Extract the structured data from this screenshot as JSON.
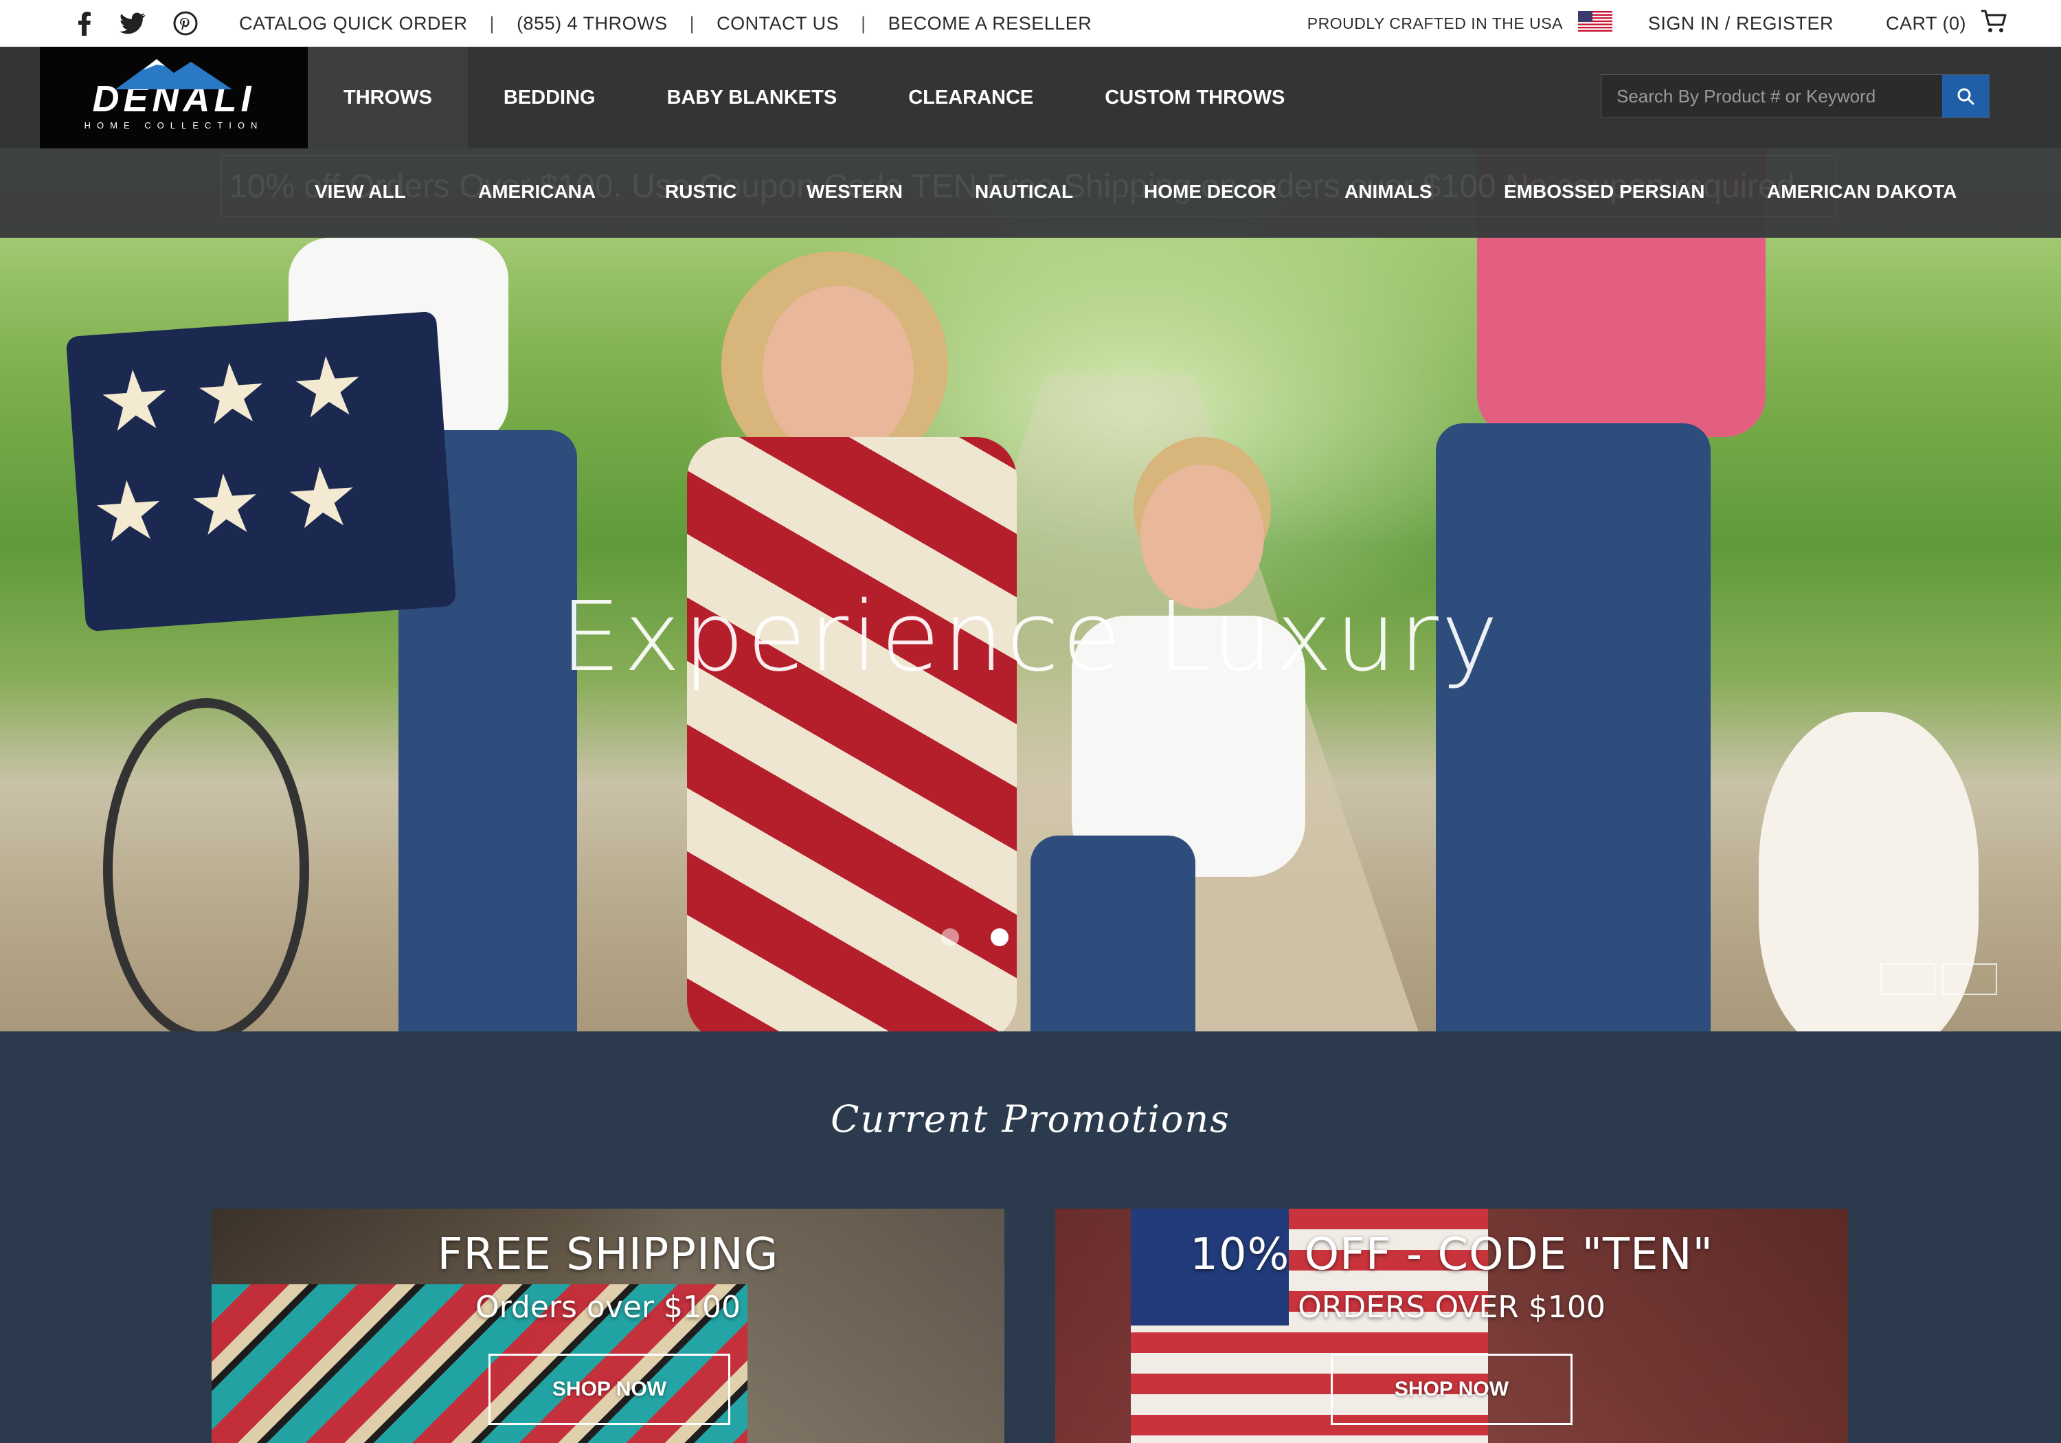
{
  "topbar": {
    "social_icons": [
      "facebook-icon",
      "twitter-icon",
      "pinterest-icon"
    ],
    "links": [
      "CATALOG QUICK ORDER",
      "(855) 4 THROWS",
      "CONTACT US",
      "BECOME A RESELLER"
    ],
    "separator": "|",
    "crafted": "PROUDLY CRAFTED IN THE USA",
    "signin": "SIGN IN / REGISTER",
    "cart": "CART (0)"
  },
  "brand": {
    "logo_text": "DENALI",
    "logo_sub": "HOME COLLECTION",
    "logo_colors": {
      "bg": "#050505",
      "mountain": "#2a79c6"
    }
  },
  "nav": {
    "items": [
      "THROWS",
      "BEDDING",
      "BABY BLANKETS",
      "CLEARANCE",
      "CUSTOM THROWS"
    ],
    "active": "THROWS"
  },
  "search": {
    "placeholder": "Search By Product # or Keyword",
    "button_icon": "search-icon",
    "button_color": "#1f5fa8"
  },
  "subnav": {
    "items": [
      "VIEW ALL",
      "AMERICANA",
      "RUSTIC",
      "WESTERN",
      "NAUTICAL",
      "HOME DECOR",
      "ANIMALS",
      "EMBOSSED PERSIAN",
      "AMERICAN DAKOTA"
    ],
    "background_banner": "10% off Orders Over $100. Use Coupon Code TEN   Free Shipping on orders over $100 No coupon required"
  },
  "hero": {
    "title": "Experience Luxury",
    "slides": 2,
    "active_slide": 2
  },
  "promotions": {
    "title": "Current Promotions",
    "background": "#2b3a4d",
    "cards": [
      {
        "title": "FREE SHIPPING",
        "subtitle": "Orders over $100",
        "button": "SHOP NOW"
      },
      {
        "title": "10% OFF - CODE \"TEN\"",
        "subtitle": "ORDERS OVER $100",
        "button": "SHOP NOW"
      }
    ]
  }
}
